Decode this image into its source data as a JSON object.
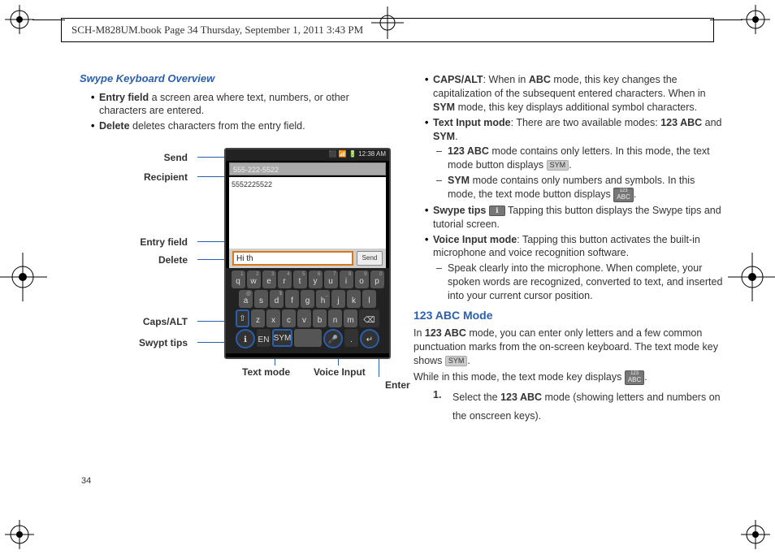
{
  "header_text": "SCH-M828UM.book  Page 34  Thursday, September 1, 2011  3:43 PM",
  "page_number": "34",
  "left": {
    "heading": "Swype Keyboard Overview",
    "bullets": {
      "b1_bold": "Entry field",
      "b1_rest": " a screen area where text, numbers, or other characters are entered.",
      "b2_bold": "Delete",
      "b2_rest": " deletes characters from the entry field."
    },
    "labels": {
      "send": "Send",
      "recipient": "Recipient",
      "entry": "Entry field",
      "delete": "Delete",
      "caps": "Caps/ALT",
      "swypt": "Swypt tips",
      "textmode": "Text mode",
      "voice": "Voice Input",
      "enter": "Enter"
    },
    "phone": {
      "status": "⬛ 📶 🔋 12:38 AM",
      "recipient_value": "555-222-5522",
      "form_tag": "5552225522",
      "entry_value": "Hi th",
      "send_btn": "Send"
    },
    "kbd": {
      "row1": [
        "q",
        "w",
        "e",
        "r",
        "t",
        "y",
        "u",
        "i",
        "o",
        "p"
      ],
      "row1_sup": [
        "1",
        "2",
        "3",
        "4",
        "5",
        "6",
        "7",
        "8",
        "9",
        "0"
      ],
      "row2": [
        "a",
        "s",
        "d",
        "f",
        "g",
        "h",
        "j",
        "k",
        "l"
      ],
      "row2_sup": [
        "@",
        "",
        "$",
        "",
        "",
        "_",
        "",
        "",
        ""
      ],
      "row3_shift": "⇧",
      "row3": [
        "z",
        "x",
        "c",
        "v",
        "b",
        "n",
        "m"
      ],
      "row3_del": "⌫",
      "row4": [
        "ℹ",
        "EN",
        "SYM",
        "",
        "",
        ".",
        "↵"
      ],
      "row4_labels": {
        "tips": "ℹ",
        "lang": "EN",
        "sym": "SYM",
        "space": "",
        "mic": "🎤",
        "dot": ".",
        "enter": "↵"
      }
    }
  },
  "right": {
    "items": {
      "caps_bold": "CAPS/ALT",
      "caps_rest_a": ": When in ",
      "caps_abc": "ABC",
      "caps_rest_b": " mode, this key changes the capitalization of the subsequent entered characters. When in ",
      "caps_sym": "SYM",
      "caps_rest_c": " mode, this key displays additional symbol characters.",
      "text_bold": "Text Input mode",
      "text_rest_a": ": There are two available modes: ",
      "text_123abc": "123 ABC",
      "text_and": " and ",
      "text_sym": "SYM",
      "text_period": ".",
      "dash1_bold": "123 ABC",
      "dash1_rest": " mode contains only letters. In this mode, the text mode button displays ",
      "chip_sym": "SYM",
      "dash2_bold": "SYM",
      "dash2_rest": " mode contains only numbers and symbols. In this mode, the text mode button displays ",
      "chip_abc_sup": "123",
      "chip_abc_main": "ABC",
      "swype_bold": "Swype tips",
      "swype_rest": " Tapping this button displays the Swype tips and tutorial screen.",
      "voice_bold": "Voice Input mode",
      "voice_rest": ": Tapping this button activates the built-in microphone and voice recognition software.",
      "voice_dash": "Speak clearly into the microphone. When complete, your spoken words are recognized, converted to text, and inserted into your current cursor position."
    },
    "h2": "123 ABC Mode",
    "p1_a": "In ",
    "p1_bold": "123 ABC",
    "p1_b": " mode, you can enter only letters and a few common punctuation marks from the on-screen keyboard. The text mode key shows ",
    "p1_chip": "SYM",
    "p1_c": ".",
    "p2_a": "While in this mode, the text mode key displays ",
    "p2_chip_sup": "123",
    "p2_chip_main": "ABC",
    "p2_b": ".",
    "step1_n": "1.",
    "step1_a": "Select the ",
    "step1_bold": "123 ABC",
    "step1_b": " mode (showing letters and numbers on the onscreen keys)."
  }
}
